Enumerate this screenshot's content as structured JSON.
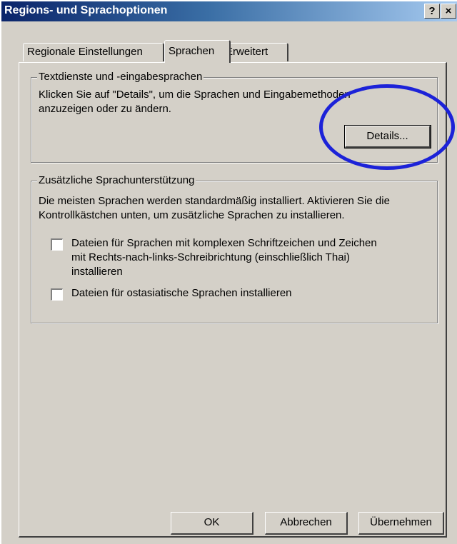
{
  "window": {
    "title": "Regions- und Sprachoptionen",
    "help_label": "?",
    "close_label": "×"
  },
  "tabs": [
    {
      "label": "Regionale Einstellungen"
    },
    {
      "label": "Sprachen"
    },
    {
      "label": "Erweitert"
    }
  ],
  "text_services": {
    "legend": "Textdienste und -eingabesprachen",
    "line1": "Klicken Sie auf \"Details\", um die Sprachen und Eingabemethoden",
    "line2": "anzuzeigen oder zu ändern.",
    "details_label": "Details..."
  },
  "supplemental": {
    "legend": "Zusätzliche Sprachunterstützung",
    "line1": "Die meisten Sprachen werden standardmäßig installiert. Aktivieren Sie die",
    "line2": "Kontrollkästchen unten, um zusätzliche Sprachen zu installieren.",
    "complex_line1": "Dateien für Sprachen mit komplexen Schriftzeichen und Zeichen",
    "complex_line2": "mit Rechts-nach-links-Schreibrichtung (einschließlich Thai)",
    "complex_line3": "installieren",
    "eastasian": "Dateien für ostasiatische Sprachen installieren"
  },
  "buttons": {
    "ok": "OK",
    "cancel": "Abbrechen",
    "apply": "Übernehmen"
  },
  "colors": {
    "annotation": "#1c22d8",
    "titlebar": "#0a246a",
    "face": "#d4d0c8"
  }
}
